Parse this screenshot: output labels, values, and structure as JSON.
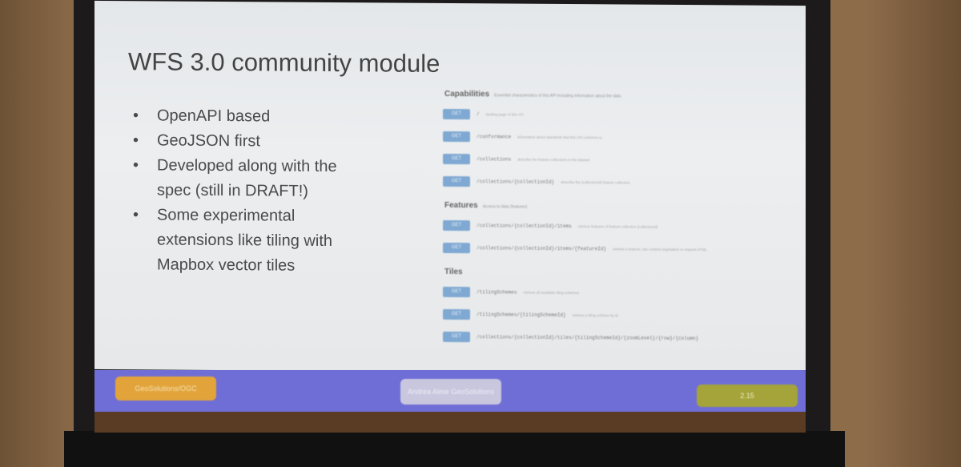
{
  "slide": {
    "title": "WFS 3.0 community module",
    "bullets": [
      "OpenAPI based",
      "GeoJSON first",
      "Developed along with the spec (still in DRAFT!)",
      "Some experimental extensions like tiling with Mapbox vector tiles"
    ],
    "api": {
      "method": "GET",
      "sections": [
        {
          "name": "Capabilities",
          "desc": "Essential characteristics of this API including information about the data",
          "endpoints": [
            {
              "path": "/",
              "desc": "landing page of this API"
            },
            {
              "path": "/conformance",
              "desc": "information about standards that this API conforms to"
            },
            {
              "path": "/collections",
              "desc": "describe the feature collections in the dataset"
            },
            {
              "path": "/collections/{collectionId}",
              "desc": "describe the {collectionId} feature collection"
            }
          ]
        },
        {
          "name": "Features",
          "desc": "Access to data (features)",
          "endpoints": [
            {
              "path": "/collections/{collectionId}/items",
              "desc": "retrieve features of feature collection {collectionId}"
            },
            {
              "path": "/collections/{collectionId}/items/{featureId}",
              "desc": "retrieve a feature; use content negotiation to request HTML"
            }
          ]
        },
        {
          "name": "Tiles",
          "desc": "",
          "endpoints": [
            {
              "path": "/tilingSchemes",
              "desc": "retrieve all available tiling schemes"
            },
            {
              "path": "/tilingSchemes/{tilingSchemeId}",
              "desc": "retrieve a tiling scheme by id"
            },
            {
              "path": "/collections/{collectionId}/tiles/{tilingSchemeId}/{zoomLevel}/{row}/{column}",
              "desc": ""
            }
          ]
        }
      ]
    },
    "footer": {
      "left": "GeoSolutions/OGC",
      "center": "Andrea Aime GeoSolutions",
      "page": "2.15"
    }
  }
}
